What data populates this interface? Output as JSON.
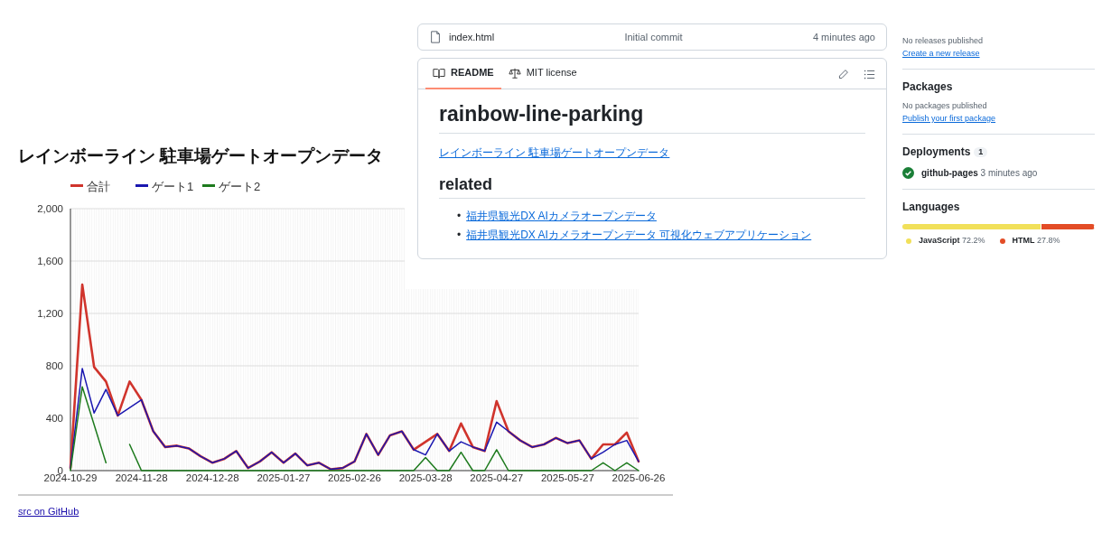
{
  "chart_page": {
    "title": "レインボーライン 駐車場ゲートオープンデータ",
    "chart": {
      "chart_data": {
        "type": "line",
        "categories": [
          "2024-10-29",
          null,
          null,
          null,
          null,
          null,
          "2024-11-28",
          null,
          null,
          null,
          null,
          null,
          "2024-12-28",
          null,
          null,
          null,
          null,
          null,
          "2025-01-27",
          null,
          null,
          null,
          null,
          null,
          "2025-02-26",
          null,
          null,
          null,
          null,
          null,
          "2025-03-28",
          null,
          null,
          null,
          null,
          null,
          "2025-04-27",
          null,
          null,
          null,
          null,
          null,
          "2025-05-27",
          null,
          null,
          null,
          null,
          null,
          "2025-06-26"
        ],
        "series": [
          {
            "name": "合計",
            "color": "#d0342c",
            "values": [
              20,
              1420,
              790,
              680,
              420,
              680,
              540,
              300,
              180,
              190,
              170,
              110,
              60,
              90,
              150,
              20,
              70,
              140,
              60,
              130,
              40,
              60,
              10,
              20,
              70,
              280,
              120,
              270,
              300,
              160,
              220,
              280,
              150,
              360,
              180,
              150,
              530,
              300,
              230,
              180,
              200,
              250,
              210,
              230,
              90,
              200,
              200,
              290,
              70
            ]
          },
          {
            "name": "ゲート1",
            "color": "#1a17b0",
            "values": [
              20,
              780,
              440,
              620,
              420,
              480,
              540,
              300,
              180,
              190,
              170,
              110,
              60,
              90,
              150,
              20,
              70,
              140,
              60,
              130,
              40,
              60,
              10,
              20,
              70,
              280,
              120,
              270,
              300,
              160,
              120,
              280,
              150,
              220,
              180,
              150,
              370,
              300,
              230,
              180,
              200,
              250,
              210,
              230,
              90,
              140,
              200,
              230,
              70
            ]
          },
          {
            "name": "ゲート2",
            "color": "#1d7a1d",
            "values": [
              0,
              640,
              350,
              60,
              null,
              200,
              0,
              0,
              0,
              0,
              0,
              0,
              0,
              0,
              0,
              0,
              0,
              0,
              0,
              0,
              0,
              0,
              0,
              0,
              0,
              0,
              0,
              0,
              0,
              0,
              100,
              0,
              0,
              140,
              0,
              0,
              160,
              0,
              0,
              0,
              0,
              0,
              0,
              0,
              0,
              60,
              0,
              60,
              0
            ]
          }
        ],
        "ylim": [
          0,
          2000
        ],
        "grid": true,
        "legend": true,
        "yticks": [
          {
            "value": 0,
            "label": "0"
          },
          {
            "value": 400,
            "label": "400"
          },
          {
            "value": 800,
            "label": "800"
          },
          {
            "value": 1200,
            "label": "1,200"
          },
          {
            "value": 1600,
            "label": "1,600"
          },
          {
            "value": 2000,
            "label": "2,000"
          }
        ]
      }
    },
    "footer_link": "src on GitHub"
  },
  "repo": {
    "file_row": {
      "name": "index.html",
      "commit": "Initial commit",
      "time": "4 minutes ago"
    },
    "readme": {
      "tabs": [
        {
          "label": "README",
          "selected": true
        },
        {
          "label": "MIT license",
          "selected": false
        }
      ],
      "heading": "rainbow-line-parking",
      "link": "レインボーライン 駐車場ゲートオープンデータ",
      "subheading": "related",
      "related_links": [
        {
          "marker": "•",
          "text": "福井県観光DX AIカメラオープンデータ"
        },
        {
          "marker": "•",
          "text": "福井県観光DX AIカメラオープンデータ 可視化ウェブアプリケーション"
        }
      ]
    }
  },
  "sidebar": {
    "releases": {
      "note": "No releases published",
      "link": "Create a new release"
    },
    "packages": {
      "title": "Packages",
      "note": "No packages published",
      "link": "Publish your first package"
    },
    "deployments": {
      "title": "Deployments",
      "count": "1",
      "items": [
        {
          "name": "github-pages",
          "time": "3 minutes ago"
        }
      ]
    },
    "languages": {
      "title": "Languages",
      "items": [
        {
          "name": "JavaScript",
          "percent": "72.2%",
          "color": "#f1e05a"
        },
        {
          "name": "HTML",
          "percent": "27.8%",
          "color": "#e34c26"
        }
      ]
    }
  }
}
